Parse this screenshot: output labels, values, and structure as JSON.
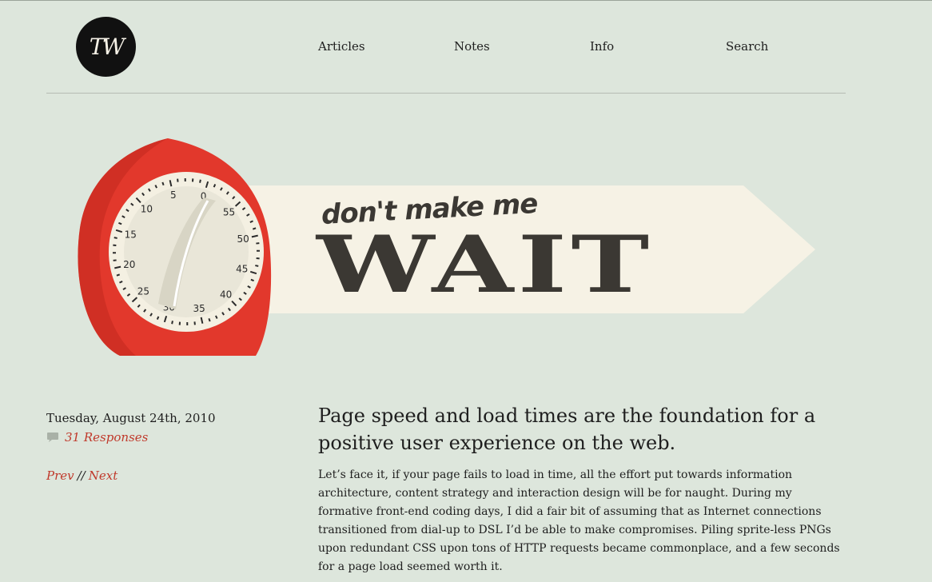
{
  "header": {
    "logo_text": "TW",
    "nav": [
      {
        "label": "Articles"
      },
      {
        "label": "Notes"
      },
      {
        "label": "Info"
      },
      {
        "label": "Search"
      }
    ]
  },
  "hero": {
    "tagline": "don't make me",
    "title": "WAIT",
    "timer_numbers": [
      "0",
      "5",
      "10",
      "15",
      "20",
      "25",
      "30",
      "35",
      "40",
      "45",
      "50",
      "55"
    ],
    "colors": {
      "timer_red": "#e2382c",
      "banner": "#f6f2e5",
      "text": "#3b3833"
    }
  },
  "meta": {
    "date": "Tuesday, August 24th, 2010",
    "responses": "31 Responses",
    "comment_icon": "comment-bubble-icon",
    "prev_label": "Prev",
    "separator": "//",
    "next_label": "Next"
  },
  "article": {
    "title": "Page speed and load times are the foundation for a positive user experience on the web.",
    "body": "Let’s face it, if your page fails to load in time, all the effort put towards information architecture, content strategy and interaction design will be for naught. During my formative front-end coding days, I did a fair bit of assuming that as Internet connections transitioned from dial-up to DSL I’d be able to make compromises.  Piling sprite-less PNGs upon redundant CSS upon tons of HTTP requests became commonplace, and a few seconds for a page load seemed worth it."
  },
  "colors": {
    "background": "#dde6dc",
    "link": "#c0392b"
  }
}
